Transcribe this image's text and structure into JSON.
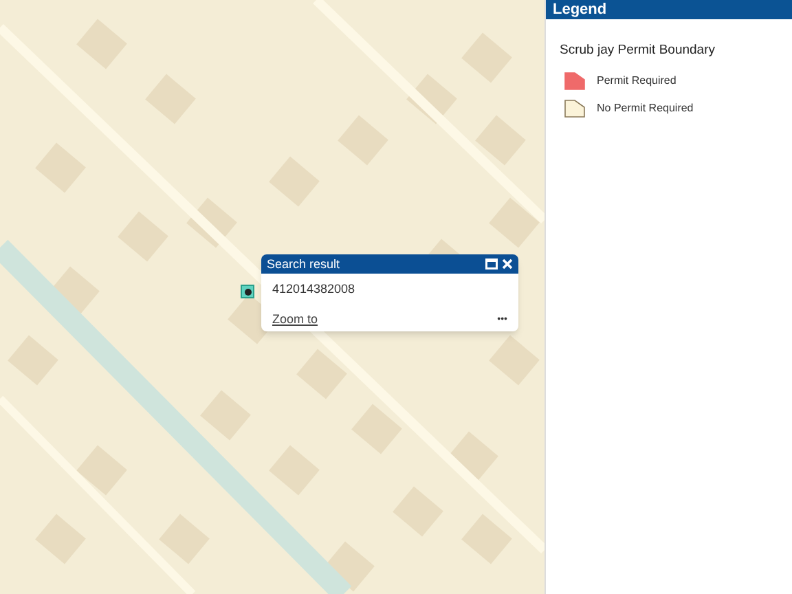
{
  "popup": {
    "title": "Search result",
    "value": "412014382008",
    "link": "Zoom to",
    "menu": "•••"
  },
  "legend": {
    "title": "Legend",
    "layer": "Scrub jay Permit Boundary",
    "items": [
      {
        "label": "Permit Required",
        "color": "#ef6a6a"
      },
      {
        "label": "No Permit Required",
        "color": "#fbf3d9"
      }
    ]
  }
}
